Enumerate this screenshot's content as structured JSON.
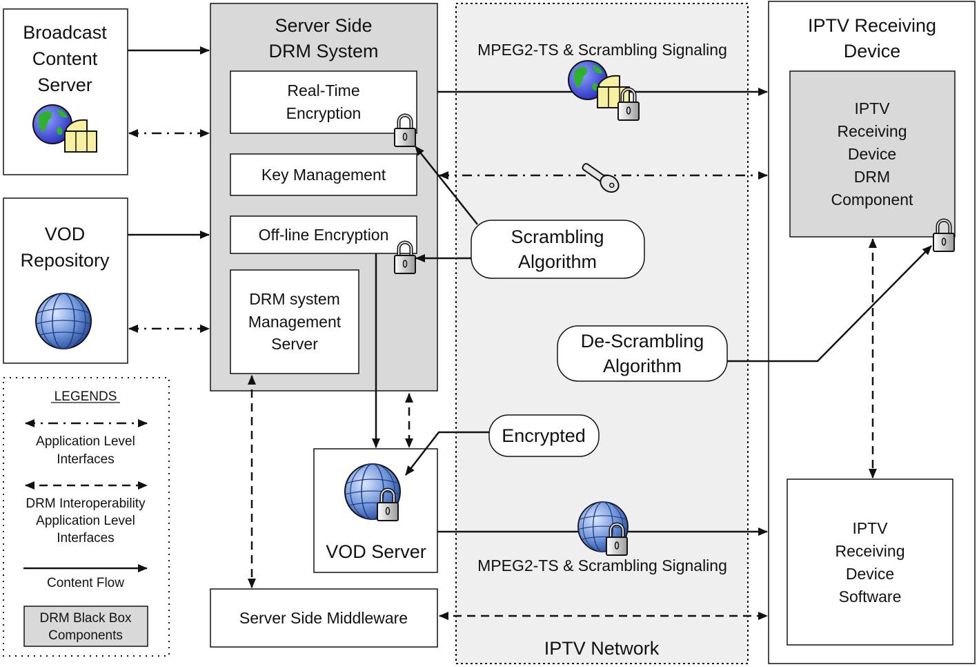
{
  "broadcast_server": {
    "lines": [
      "Broadcast",
      "Content",
      "Server"
    ],
    "icon": "globe-film-icon"
  },
  "vod_repository": {
    "lines": [
      "VOD",
      "Repository"
    ],
    "icon": "globe-icon"
  },
  "server_drm": {
    "title": [
      "Server Side",
      "DRM System"
    ],
    "realtime": [
      "Real-Time",
      "Encryption"
    ],
    "key_management": "Key Management",
    "offline": "Off-line Encryption",
    "mgmt_server": [
      "DRM system",
      "Management",
      "Server"
    ]
  },
  "vod_server": {
    "label": "VOD Server",
    "icon": "globe-lock-icon"
  },
  "middleware": "Server Side Middleware",
  "network": {
    "label": "IPTV Network",
    "top_signal": "MPEG2-TS & Scrambling Signaling",
    "bottom_signal": "MPEG2-TS & Scrambling Signaling",
    "scrambling": [
      "Scrambling",
      "Algorithm"
    ],
    "descrambling": [
      "De-Scrambling",
      "Algorithm"
    ],
    "encrypted": "Encrypted"
  },
  "device": {
    "title": [
      "IPTV Receiving",
      "Device"
    ],
    "drm_component": [
      "IPTV",
      "Receiving",
      "Device",
      "DRM",
      "Component"
    ],
    "software": [
      "IPTV",
      "Receiving",
      "Device",
      "Software"
    ]
  },
  "legend": {
    "title": "LEGENDS",
    "app_level": [
      "Application Level",
      "Interfaces"
    ],
    "drm_interop": [
      "DRM Interoperability",
      "Application Level",
      "Interfaces"
    ],
    "content_flow": "Content Flow",
    "black_box": [
      "DRM Black Box",
      "Components"
    ]
  },
  "colors": {
    "black_box_fill": "#d9d9d9",
    "network_fill": "#efefef"
  }
}
